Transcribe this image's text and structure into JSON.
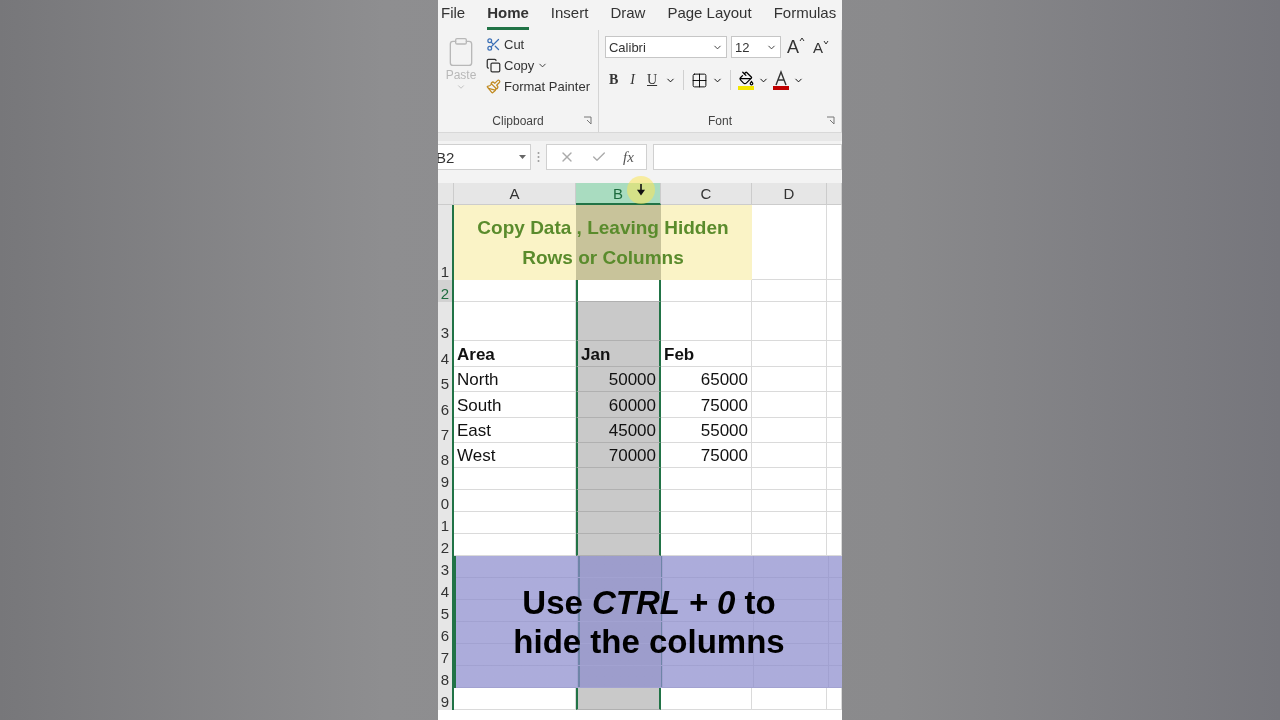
{
  "ribbon": {
    "tabs": [
      {
        "label": "File",
        "selected": false
      },
      {
        "label": "Home",
        "selected": true
      },
      {
        "label": "Insert",
        "selected": false
      },
      {
        "label": "Draw",
        "selected": false
      },
      {
        "label": "Page Layout",
        "selected": false
      },
      {
        "label": "Formulas",
        "selected": false
      }
    ],
    "clipboard": {
      "paste": {
        "label": "Paste",
        "disabled": true
      },
      "cut": "Cut",
      "copy": "Copy",
      "format_painter": "Format Painter",
      "group_label": "Clipboard"
    },
    "font": {
      "font_name": "Calibri",
      "font_size": "12",
      "grow": "A",
      "shrink": "A",
      "bold": "B",
      "italic": "I",
      "underline": "U",
      "group_label": "Font"
    }
  },
  "formula_bar": {
    "name_box": "B2",
    "function_label": "fx"
  },
  "sheet": {
    "columns": [
      {
        "label": "A",
        "selected": false
      },
      {
        "label": "B",
        "selected": true
      },
      {
        "label": "C",
        "selected": false
      },
      {
        "label": "D",
        "selected": false
      }
    ],
    "rows": [
      {
        "header": "1",
        "kind": "title",
        "cells": [
          "Copy Data , Leaving Hidden Rows or Columns"
        ],
        "active": false
      },
      {
        "header": "2",
        "kind": "empty",
        "cells": [],
        "active": true
      },
      {
        "header": "3",
        "kind": "empty",
        "cells": [],
        "active": false
      },
      {
        "header": "4",
        "kind": "heading",
        "cells": [
          "Area",
          "Jan",
          "Feb"
        ],
        "active": false
      },
      {
        "header": "5",
        "kind": "data",
        "cells": [
          "North",
          "50000",
          "65000"
        ],
        "active": false
      },
      {
        "header": "6",
        "kind": "data",
        "cells": [
          "South",
          "60000",
          "75000"
        ],
        "active": false
      },
      {
        "header": "7",
        "kind": "data",
        "cells": [
          "East",
          "45000",
          "55000"
        ],
        "active": false
      },
      {
        "header": "8",
        "kind": "data",
        "cells": [
          "West",
          "70000",
          "75000"
        ],
        "active": false
      },
      {
        "header": "9",
        "kind": "empty",
        "cells": [],
        "active": false
      },
      {
        "header": "0",
        "kind": "empty",
        "cells": [],
        "active": false
      },
      {
        "header": "1",
        "kind": "empty",
        "cells": [],
        "active": false
      },
      {
        "header": "2",
        "kind": "empty",
        "cells": [],
        "active": false
      },
      {
        "header": "3",
        "kind": "under_caption",
        "cells": [],
        "active": false
      },
      {
        "header": "4",
        "kind": "under_caption",
        "cells": [],
        "active": false
      },
      {
        "header": "5",
        "kind": "under_caption",
        "cells": [],
        "active": false
      },
      {
        "header": "6",
        "kind": "under_caption",
        "cells": [],
        "active": false
      },
      {
        "header": "7",
        "kind": "under_caption",
        "cells": [],
        "active": false
      },
      {
        "header": "8",
        "kind": "under_caption",
        "cells": [],
        "active": false
      },
      {
        "header": "9",
        "kind": "empty",
        "cells": [],
        "active": false
      }
    ]
  },
  "caption": "Use *CTRL + 0* to hide the columns"
}
